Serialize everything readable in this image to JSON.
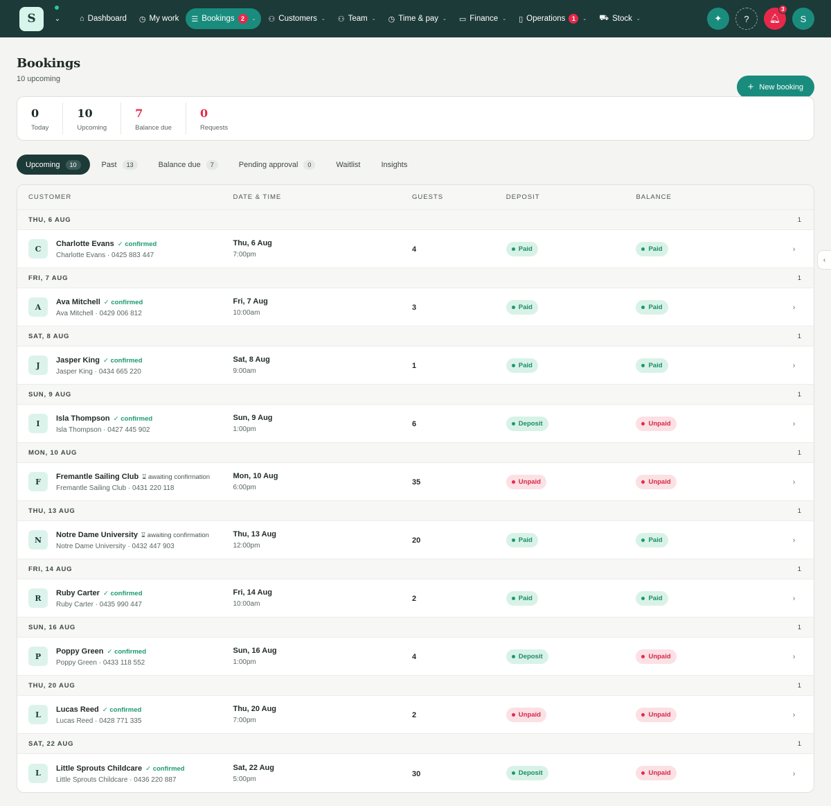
{
  "brand": {
    "logo_letter": "S"
  },
  "nav": [
    {
      "label": "Dashboard",
      "icon": "home-icon",
      "glyph": "⌂",
      "caret": false,
      "badge": null,
      "active": false
    },
    {
      "label": "My work",
      "icon": "clock-icon",
      "glyph": "◷",
      "caret": false,
      "badge": null,
      "active": false
    },
    {
      "label": "Bookings",
      "icon": "list-icon",
      "glyph": "☰",
      "caret": true,
      "badge": "2",
      "active": true
    },
    {
      "label": "Customers",
      "icon": "users-icon",
      "glyph": "⚇",
      "caret": true,
      "badge": null,
      "active": false
    },
    {
      "label": "Team",
      "icon": "team-icon",
      "glyph": "⚇",
      "caret": true,
      "badge": null,
      "active": false
    },
    {
      "label": "Time & pay",
      "icon": "clock-icon",
      "glyph": "◷",
      "caret": true,
      "badge": null,
      "active": false
    },
    {
      "label": "Finance",
      "icon": "card-icon",
      "glyph": "▭",
      "caret": true,
      "badge": null,
      "active": false
    },
    {
      "label": "Operations",
      "icon": "clipboard-icon",
      "glyph": "▯",
      "caret": true,
      "badge": "1",
      "active": false
    },
    {
      "label": "Stock",
      "icon": "cart-icon",
      "glyph": "⛟",
      "caret": true,
      "badge": null,
      "active": false
    }
  ],
  "topright": {
    "notifications_badge": "3",
    "avatar_letter": "S"
  },
  "page": {
    "title": "Bookings",
    "subtitle": "10 upcoming",
    "new_button": "New booking"
  },
  "stats": [
    {
      "value": "0",
      "label": "Today",
      "red": false
    },
    {
      "value": "10",
      "label": "Upcoming",
      "red": false
    },
    {
      "value": "7",
      "label": "Balance due",
      "red": true
    },
    {
      "value": "0",
      "label": "Requests",
      "red": true
    }
  ],
  "tabs": [
    {
      "label": "Upcoming",
      "count": "10",
      "active": true
    },
    {
      "label": "Past",
      "count": "13",
      "active": false
    },
    {
      "label": "Balance due",
      "count": "7",
      "active": false
    },
    {
      "label": "Pending approval",
      "count": "0",
      "active": false
    },
    {
      "label": "Waitlist",
      "count": null,
      "active": false
    },
    {
      "label": "Insights",
      "count": null,
      "active": false
    }
  ],
  "columns": {
    "customer": "CUSTOMER",
    "datetime": "DATE & TIME",
    "guests": "GUESTS",
    "deposit": "DEPOSIT",
    "balance": "BALANCE"
  },
  "groups": [
    {
      "header": "THU, 6 AUG",
      "count": "1",
      "booking": {
        "initial": "C",
        "name": "Charlotte Evans",
        "status": "confirmed",
        "sub": "Charlotte Evans · 0425 883 447",
        "date": "Thu, 6 Aug",
        "time": "7:00pm",
        "guests": "4",
        "deposit": "Paid",
        "balance": "Paid"
      }
    },
    {
      "header": "FRI, 7 AUG",
      "count": "1",
      "booking": {
        "initial": "A",
        "name": "Ava Mitchell",
        "status": "confirmed",
        "sub": "Ava Mitchell · 0429 006 812",
        "date": "Fri, 7 Aug",
        "time": "10:00am",
        "guests": "3",
        "deposit": "Paid",
        "balance": "Paid"
      }
    },
    {
      "header": "SAT, 8 AUG",
      "count": "1",
      "booking": {
        "initial": "J",
        "name": "Jasper King",
        "status": "confirmed",
        "sub": "Jasper King · 0434 665 220",
        "date": "Sat, 8 Aug",
        "time": "9:00am",
        "guests": "1",
        "deposit": "Paid",
        "balance": "Paid"
      }
    },
    {
      "header": "SUN, 9 AUG",
      "count": "1",
      "booking": {
        "initial": "I",
        "name": "Isla Thompson",
        "status": "confirmed",
        "sub": "Isla Thompson · 0427 445 902",
        "date": "Sun, 9 Aug",
        "time": "1:00pm",
        "guests": "6",
        "deposit": "Deposit",
        "balance": "Unpaid"
      }
    },
    {
      "header": "MON, 10 AUG",
      "count": "1",
      "booking": {
        "initial": "F",
        "name": "Fremantle Sailing Club",
        "status": "awaiting confirmation",
        "sub": "Fremantle Sailing Club · 0431 220 118",
        "date": "Mon, 10 Aug",
        "time": "6:00pm",
        "guests": "35",
        "deposit": "Unpaid",
        "balance": "Unpaid"
      }
    },
    {
      "header": "THU, 13 AUG",
      "count": "1",
      "booking": {
        "initial": "N",
        "name": "Notre Dame University",
        "status": "awaiting confirmation",
        "sub": "Notre Dame University · 0432 447 903",
        "date": "Thu, 13 Aug",
        "time": "12:00pm",
        "guests": "20",
        "deposit": "Paid",
        "balance": "Paid"
      }
    },
    {
      "header": "FRI, 14 AUG",
      "count": "1",
      "booking": {
        "initial": "R",
        "name": "Ruby Carter",
        "status": "confirmed",
        "sub": "Ruby Carter · 0435 990 447",
        "date": "Fri, 14 Aug",
        "time": "10:00am",
        "guests": "2",
        "deposit": "Paid",
        "balance": "Paid"
      }
    },
    {
      "header": "SUN, 16 AUG",
      "count": "1",
      "booking": {
        "initial": "P",
        "name": "Poppy Green",
        "status": "confirmed",
        "sub": "Poppy Green · 0433 118 552",
        "date": "Sun, 16 Aug",
        "time": "1:00pm",
        "guests": "4",
        "deposit": "Deposit",
        "balance": "Unpaid"
      }
    },
    {
      "header": "THU, 20 AUG",
      "count": "1",
      "booking": {
        "initial": "L",
        "name": "Lucas Reed",
        "status": "confirmed",
        "sub": "Lucas Reed · 0428 771 335",
        "date": "Thu, 20 Aug",
        "time": "7:00pm",
        "guests": "2",
        "deposit": "Unpaid",
        "balance": "Unpaid"
      }
    },
    {
      "header": "SAT, 22 AUG",
      "count": "1",
      "booking": {
        "initial": "L",
        "name": "Little Sprouts Childcare",
        "status": "confirmed",
        "sub": "Little Sprouts Childcare · 0436 220 887",
        "date": "Sat, 22 Aug",
        "time": "5:00pm",
        "guests": "30",
        "deposit": "Deposit",
        "balance": "Unpaid"
      }
    }
  ],
  "colors": {
    "brand_dark": "#1c3a38",
    "accent": "#1a8c7e",
    "danger": "#e8284a",
    "success": "#1a9a6e"
  }
}
